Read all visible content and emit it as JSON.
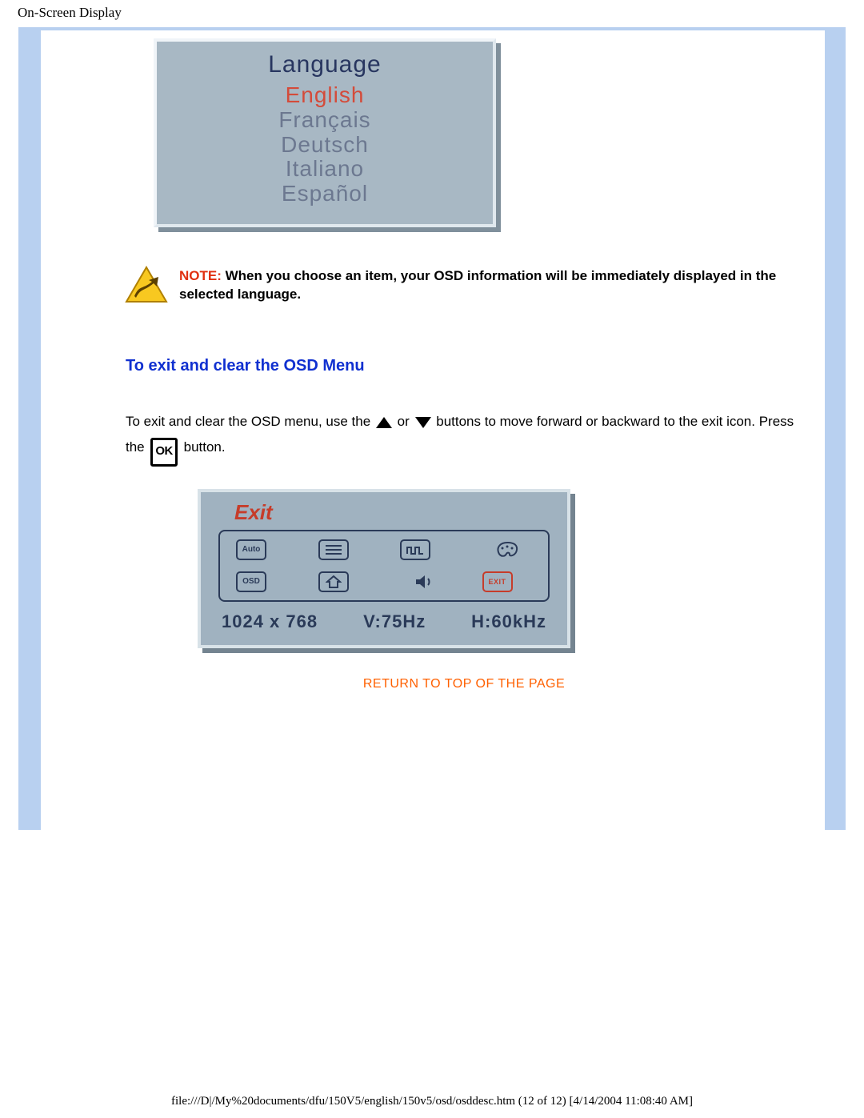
{
  "header": {
    "title": "On-Screen Display"
  },
  "language_menu": {
    "title": "Language",
    "options": [
      "English",
      "Français",
      "Deutsch",
      "Italiano",
      "Español"
    ],
    "selected": "English"
  },
  "note": {
    "label": "NOTE:",
    "text": "When you choose an item, your OSD information will be immediately displayed in the selected language."
  },
  "section": {
    "heading": "To exit and clear the OSD Menu",
    "instr_a": "To exit and clear the OSD menu, use the",
    "instr_or": "or",
    "instr_b": "buttons to move forward or backward to the exit icon. Press the",
    "instr_c": "button.",
    "ok_label": "OK"
  },
  "exit_menu": {
    "title": "Exit",
    "icons": {
      "auto": "Auto",
      "osd": "OSD",
      "exit": "EXIT"
    },
    "resolution": "1024  x  768",
    "vfreq": "V:75Hz",
    "hfreq": "H:60kHz"
  },
  "return_link": "RETURN TO TOP OF THE PAGE",
  "footer": "file:///D|/My%20documents/dfu/150V5/english/150v5/osd/osddesc.htm (12 of 12) [4/14/2004 11:08:40 AM]"
}
